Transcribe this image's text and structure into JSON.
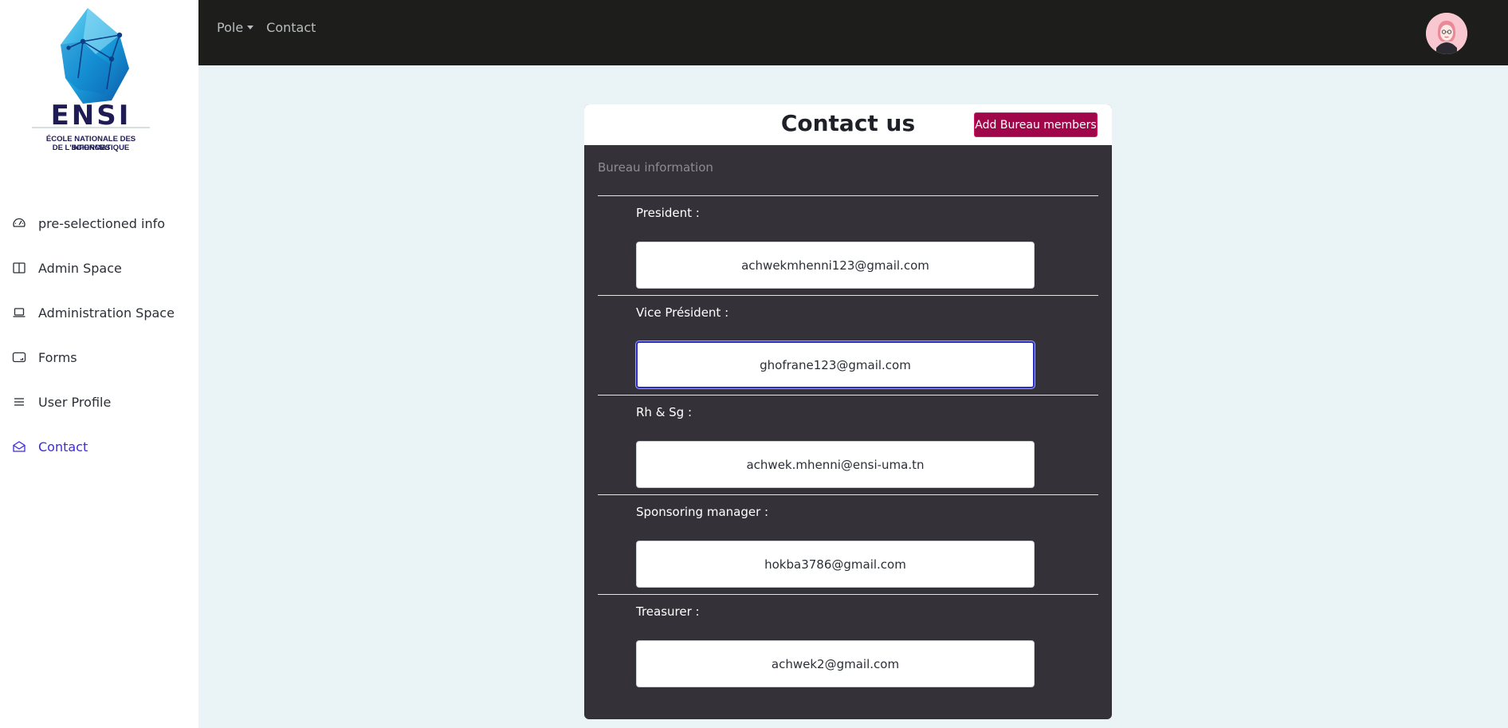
{
  "logo": {
    "wordmark": "ENSI",
    "caption_line1": "ÉCOLE NATIONALE DES SCIENCES",
    "caption_line2": "DE L'INFORMATIQUE"
  },
  "sidebar": {
    "items": [
      {
        "label": "pre-selectioned info",
        "icon": "speedometer-icon",
        "active": false
      },
      {
        "label": "Admin Space",
        "icon": "book-icon",
        "active": false
      },
      {
        "label": "Administration Space",
        "icon": "laptop-icon",
        "active": false
      },
      {
        "label": "Forms",
        "icon": "form-card-icon",
        "active": false
      },
      {
        "label": "User Profile",
        "icon": "list-icon",
        "active": false
      },
      {
        "label": "Contact",
        "icon": "envelope-open-icon",
        "active": true
      }
    ]
  },
  "topbar": {
    "pole_label": "Pole",
    "contact_label": "Contact",
    "avatar_icon": "user-avatar-icon"
  },
  "card": {
    "title": "Contact us",
    "add_button_label": "Add Bureau members",
    "section_label": "Bureau information",
    "members": [
      {
        "label": "President :",
        "email": "achwekmhenni123@gmail.com",
        "focused": false
      },
      {
        "label": "Vice Président :",
        "email": "ghofrane123@gmail.com",
        "focused": true
      },
      {
        "label": "Rh & Sg :",
        "email": "achwek.mhenni@ensi-uma.tn",
        "focused": false
      },
      {
        "label": "Sponsoring manager :",
        "email": "hokba3786@gmail.com",
        "focused": false
      },
      {
        "label": "Treasurer :",
        "email": "achwek2@gmail.com",
        "focused": false
      }
    ]
  },
  "colors": {
    "accent": "#3d2bdc",
    "button": "#a0064a",
    "topbar": "#1d1e1b",
    "card_body": "#343238",
    "page_bg": "#eaf3f6"
  }
}
